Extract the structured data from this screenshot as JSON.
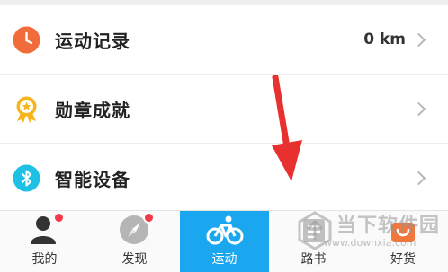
{
  "menu": {
    "items": [
      {
        "label": "运动记录",
        "value": "0 km",
        "icon": "clock-icon",
        "color": "#f26b3a"
      },
      {
        "label": "勋章成就",
        "value": "",
        "icon": "medal-icon",
        "color": "#f5b51b"
      },
      {
        "label": "智能设备",
        "value": "",
        "icon": "bluetooth-icon",
        "color": "#1ec0e4"
      }
    ]
  },
  "tabbar": {
    "tabs": [
      {
        "label": "我的",
        "icon": "user-icon",
        "badge": true
      },
      {
        "label": "发现",
        "icon": "compass-icon",
        "badge": true
      },
      {
        "label": "运动",
        "icon": "bicycle-icon",
        "active": true
      },
      {
        "label": "路书",
        "icon": "route-icon"
      },
      {
        "label": "好货",
        "icon": "shop-icon"
      }
    ]
  },
  "watermark": {
    "title": "当下软件园",
    "url": "www.downxia.com"
  },
  "colors": {
    "accent": "#1aa7ef",
    "badge": "#f2394a",
    "arrow": "#e8302f"
  }
}
